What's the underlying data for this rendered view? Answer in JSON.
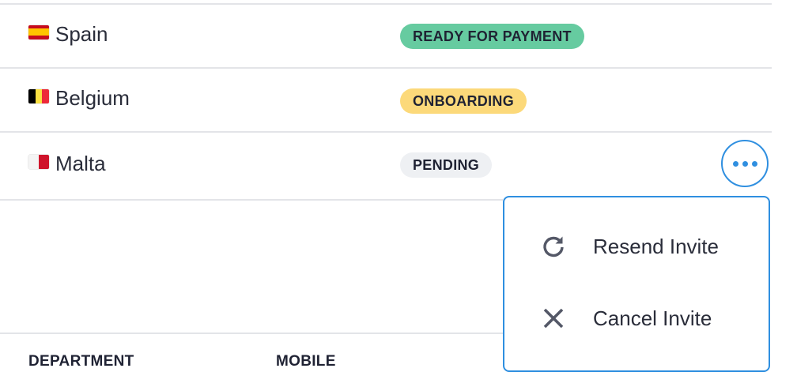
{
  "rows": [
    {
      "country": "Spain",
      "status": "READY FOR PAYMENT",
      "status_color": "#66cba0"
    },
    {
      "country": "Belgium",
      "status": "ONBOARDING",
      "status_color": "#fcd97a"
    },
    {
      "country": "Malta",
      "status": "PENDING",
      "status_color": "#eef0f3"
    }
  ],
  "menu": {
    "items": [
      {
        "label": "Resend Invite",
        "icon": "refresh-icon"
      },
      {
        "label": "Cancel Invite",
        "icon": "close-icon"
      }
    ]
  },
  "table_header": {
    "columns": [
      "DEPARTMENT",
      "MOBILE"
    ]
  },
  "colors": {
    "accent": "#2f8fe0",
    "divider": "#e3e4e8"
  }
}
